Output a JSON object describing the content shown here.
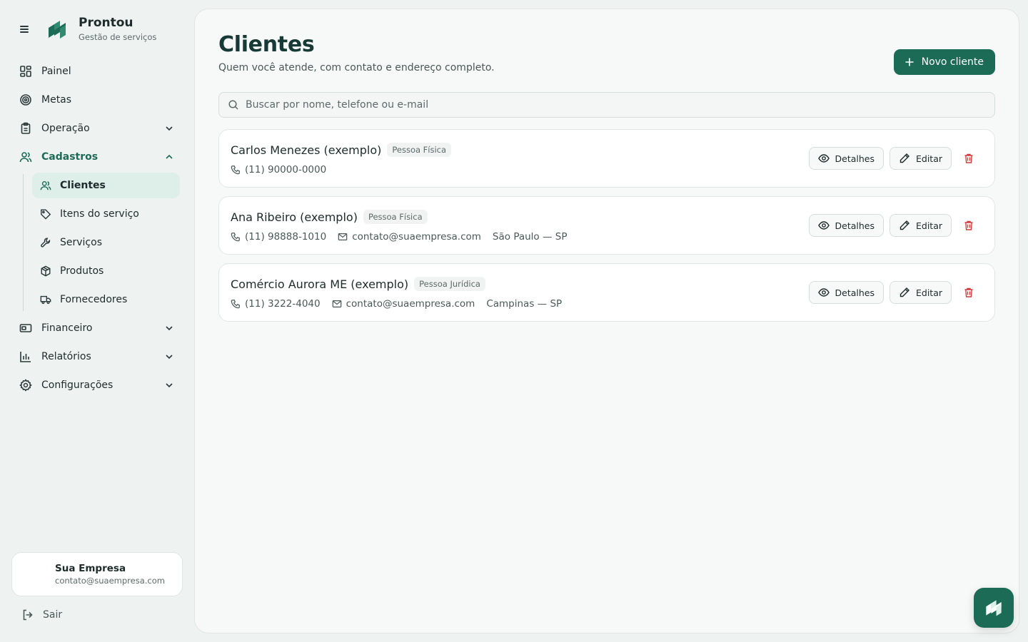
{
  "brand": {
    "name": "Prontou",
    "tagline": "Gestão de serviços"
  },
  "colors": {
    "accent": "#1c6b57",
    "danger": "#d03b3b",
    "background": "#eef2f1"
  },
  "sidebar": {
    "items": [
      {
        "label": "Painel",
        "icon": "grid-icon"
      },
      {
        "label": "Metas",
        "icon": "target-icon"
      },
      {
        "label": "Operação",
        "icon": "clipboard-icon",
        "expanded": false
      },
      {
        "label": "Cadastros",
        "icon": "users-icon",
        "expanded": true
      },
      {
        "label": "Financeiro",
        "icon": "wallet-icon",
        "expanded": false
      },
      {
        "label": "Relatórios",
        "icon": "bar-chart-icon",
        "expanded": false
      },
      {
        "label": "Configurações",
        "icon": "gear-icon",
        "expanded": false
      }
    ],
    "cadastros_sub": [
      {
        "label": "Clientes",
        "icon": "users-icon",
        "active": true
      },
      {
        "label": "Itens do serviço",
        "icon": "tag-icon"
      },
      {
        "label": "Serviços",
        "icon": "wrench-icon"
      },
      {
        "label": "Produtos",
        "icon": "package-icon"
      },
      {
        "label": "Fornecedores",
        "icon": "truck-icon"
      }
    ],
    "company": {
      "name": "Sua Empresa",
      "email": "contato@suaempresa.com"
    },
    "logout_label": "Sair"
  },
  "page": {
    "title": "Clientes",
    "subtitle": "Quem você atende, com contato e endereço completo.",
    "new_button": "Novo cliente",
    "search_placeholder": "Buscar por nome, telefone ou e-mail"
  },
  "clients": [
    {
      "name": "Carlos Menezes (exemplo)",
      "type": "Pessoa Física",
      "phone": "(11) 90000-0000",
      "email": "",
      "location": ""
    },
    {
      "name": "Ana Ribeiro (exemplo)",
      "type": "Pessoa Física",
      "phone": "(11) 98888-1010",
      "email": "contato@suaempresa.com",
      "location": "São Paulo — SP"
    },
    {
      "name": "Comércio Aurora ME (exemplo)",
      "type": "Pessoa Jurídica",
      "phone": "(11) 3222-4040",
      "email": "contato@suaempresa.com",
      "location": "Campinas — SP"
    }
  ],
  "actions": {
    "details": "Detalhes",
    "edit": "Editar"
  }
}
